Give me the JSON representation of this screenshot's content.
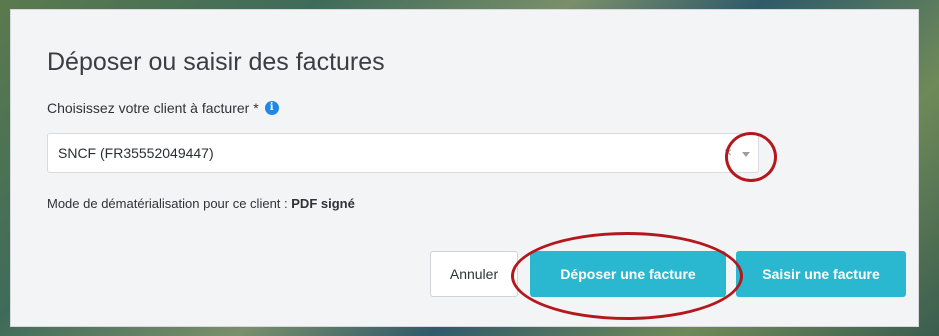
{
  "dialog": {
    "title": "Déposer ou saisir des factures",
    "client_label": "Choisissez votre client à facturer *",
    "info_glyph": "i",
    "client_select": {
      "value": "SNCF (FR35552049447)",
      "clear_glyph": "×"
    },
    "mode_prefix": "Mode de dématérialisation pour ce client :",
    "mode_value": "PDF signé"
  },
  "actions": {
    "cancel_label": "Annuler",
    "deposit_label": "Déposer une facture",
    "enter_label": "Saisir une facture"
  },
  "colors": {
    "primary": "#29b8d0",
    "annotation": "#b3191c",
    "info": "#1e88e5"
  }
}
